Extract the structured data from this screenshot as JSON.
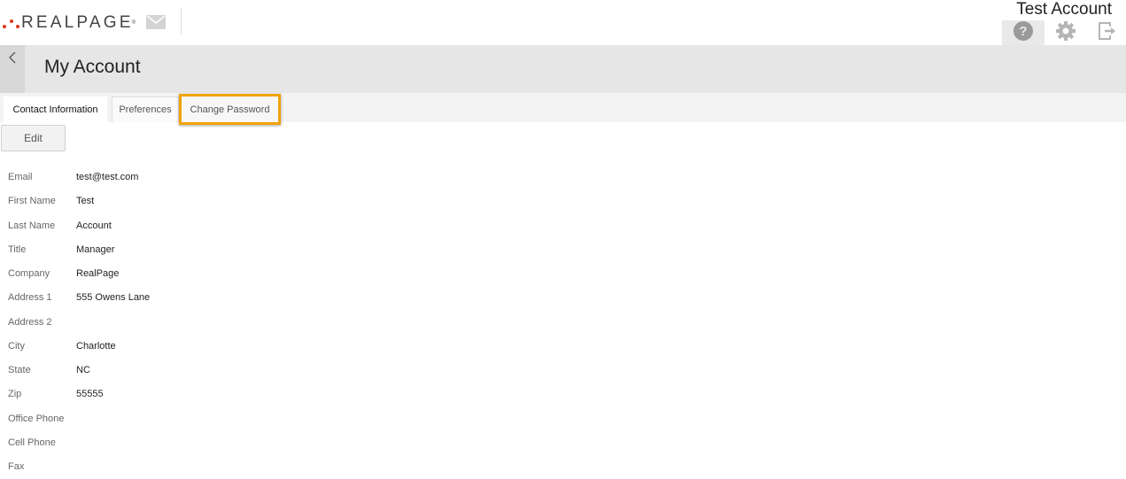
{
  "header": {
    "logo_text": "REALPAGE",
    "logo_tm": "®",
    "account_name": "Test Account",
    "icons": {
      "mail": "envelope-icon",
      "help": "question-circle-icon",
      "settings": "gear-icon",
      "logout": "logout-icon"
    },
    "brand_color": "#e0381f"
  },
  "titlebar": {
    "back_glyph": "<",
    "title": "My Account"
  },
  "tabs": [
    {
      "label": "Contact Information",
      "active": true
    },
    {
      "label": "Preferences",
      "active": false
    },
    {
      "label": "Change Password",
      "active": false,
      "highlighted": true
    }
  ],
  "highlight_color": "#f0a30a",
  "edit_label": "Edit",
  "contact": [
    {
      "label": "Email",
      "value": "test@test.com"
    },
    {
      "label": "First Name",
      "value": "Test"
    },
    {
      "label": "Last Name",
      "value": "Account"
    },
    {
      "label": "Title",
      "value": "Manager"
    },
    {
      "label": "Company",
      "value": "RealPage"
    },
    {
      "label": "Address 1",
      "value": "555 Owens Lane"
    },
    {
      "label": "Address 2",
      "value": ""
    },
    {
      "label": "City",
      "value": "Charlotte"
    },
    {
      "label": "State",
      "value": "NC"
    },
    {
      "label": "Zip",
      "value": "55555"
    },
    {
      "label": "Office Phone",
      "value": ""
    },
    {
      "label": "Cell Phone",
      "value": ""
    },
    {
      "label": "Fax",
      "value": ""
    }
  ]
}
